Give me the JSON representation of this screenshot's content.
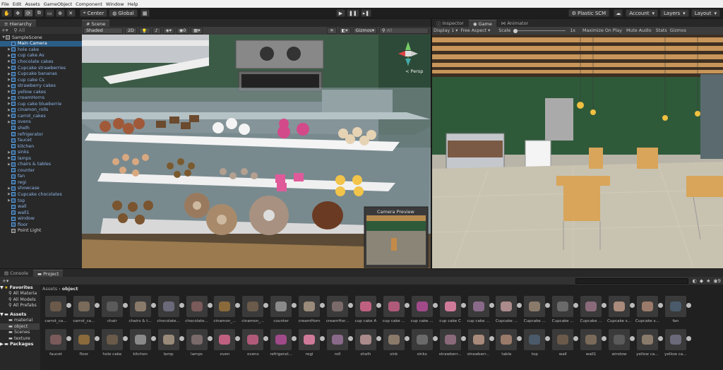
{
  "menu": [
    "File",
    "Edit",
    "Assets",
    "GameObject",
    "Component",
    "Window",
    "Help"
  ],
  "toolbar": {
    "center_label": "Center",
    "global_label": "Global",
    "plastic_label": "Plastic SCM",
    "account_label": "Account",
    "layers_label": "Layers",
    "layout_label": "Layout"
  },
  "hierarchy": {
    "tab_label": "Hierarchy",
    "search_placeholder": "All",
    "scene_name": "SampleScene",
    "items": [
      {
        "label": "Main Camera",
        "expand": false,
        "sel": true,
        "plain": false
      },
      {
        "label": "hole cake",
        "expand": true
      },
      {
        "label": "cup cake As",
        "expand": true
      },
      {
        "label": "chocolate cakes",
        "expand": true
      },
      {
        "label": "Cupcake strawberries",
        "expand": true
      },
      {
        "label": "Cupcake bananas",
        "expand": true
      },
      {
        "label": "cup cake Cs",
        "expand": true
      },
      {
        "label": "strawberry cakes",
        "expand": true
      },
      {
        "label": "yellow cakes",
        "expand": true
      },
      {
        "label": "creamHorns",
        "expand": true
      },
      {
        "label": "cup cake blueberrie",
        "expand": true
      },
      {
        "label": "cinamon_rolls",
        "expand": true
      },
      {
        "label": "carrot_cakes",
        "expand": true
      },
      {
        "label": "ovens",
        "expand": true
      },
      {
        "label": "shelh",
        "expand": false
      },
      {
        "label": "refrigerator",
        "expand": false
      },
      {
        "label": "faucet",
        "expand": false
      },
      {
        "label": "kitchen",
        "expand": false
      },
      {
        "label": "sinks",
        "expand": true
      },
      {
        "label": "lamps",
        "expand": true
      },
      {
        "label": "chairs & tables",
        "expand": true
      },
      {
        "label": "counter",
        "expand": false
      },
      {
        "label": "fan",
        "expand": false
      },
      {
        "label": "regi",
        "expand": false
      },
      {
        "label": "showcase",
        "expand": true
      },
      {
        "label": "Cupcake chocolates",
        "expand": true
      },
      {
        "label": "top",
        "expand": true
      },
      {
        "label": "wall",
        "expand": false
      },
      {
        "label": "wall1",
        "expand": false
      },
      {
        "label": "window",
        "expand": false
      },
      {
        "label": "floor",
        "expand": false
      },
      {
        "label": "Point Light",
        "expand": false,
        "plain": true
      }
    ]
  },
  "scene": {
    "tab_label": "Scene",
    "shading": "Shaded",
    "mode_2d": "2D",
    "gizmos_label": "Gizmos",
    "search_placeholder": "All",
    "persp_label": "< Persp",
    "camera_preview_label": "Camera Preview",
    "hidden_count": "0"
  },
  "game": {
    "tabs": [
      "Inspector",
      "Game",
      "Animator"
    ],
    "display": "Display 1",
    "aspect": "Free Aspect",
    "scale_label": "Scale",
    "scale_value": "1x",
    "maximize": "Maximize On Play",
    "mute": "Mute Audio",
    "stats": "Stats",
    "gizmos": "Gizmos"
  },
  "bottom": {
    "tabs": [
      "Console",
      "Project"
    ],
    "breadcrumb": [
      "Assets",
      "object"
    ],
    "hidden_count": "9",
    "favorites": {
      "label": "Favorites",
      "items": [
        "All Materia",
        "All Models",
        "All Prefabs"
      ]
    },
    "assets": {
      "label": "Assets",
      "items": [
        "material",
        "object",
        "Scenes",
        "texture"
      ]
    },
    "packages_label": "Packages",
    "row1": [
      "carrot_ca...",
      "carrot_ca...",
      "chair",
      "chairs & t...",
      "chocolate...",
      "chocolate...",
      "cinamon_...",
      "cinamon_...",
      "counter",
      "creamHorn",
      "creamHor...",
      "cup cake A",
      "cup cake ...",
      "cup cake ...",
      "cup cake C",
      "cup cake ...",
      "Cupcake ...",
      "Cupcake ...",
      "Cupcake ...",
      "Cupcake ...",
      "Cupcake s...",
      "Cupcake s...",
      "fan"
    ],
    "row2": [
      "faucet",
      "floor",
      "hole cake",
      "kitchen",
      "lamp",
      "lamps",
      "oven",
      "ovens",
      "refrigerat...",
      "regi",
      "roll",
      "shelh",
      "sink",
      "sinks",
      "strawberr...",
      "strawberr...",
      "table",
      "top",
      "wall",
      "wall1",
      "window",
      "yellow ca...",
      "yellow ca..."
    ]
  }
}
